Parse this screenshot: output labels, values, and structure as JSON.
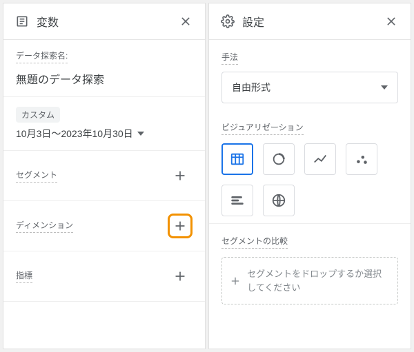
{
  "left": {
    "title": "変数",
    "explorationNameLabel": "データ探索名:",
    "explorationName": "無題のデータ探索",
    "rangeChip": "カスタム",
    "dateRange": "10月3日～2023年10月30日",
    "segments": "セグメント",
    "dimensions": "ディメンション",
    "metrics": "指標"
  },
  "right": {
    "title": "設定",
    "techniqueLabel": "手法",
    "techniqueValue": "自由形式",
    "visualizationLabel": "ビジュアリゼーション",
    "segmentCompareLabel": "セグメントの比較",
    "dropZoneText": "セグメントをドロップするか選択してください"
  }
}
